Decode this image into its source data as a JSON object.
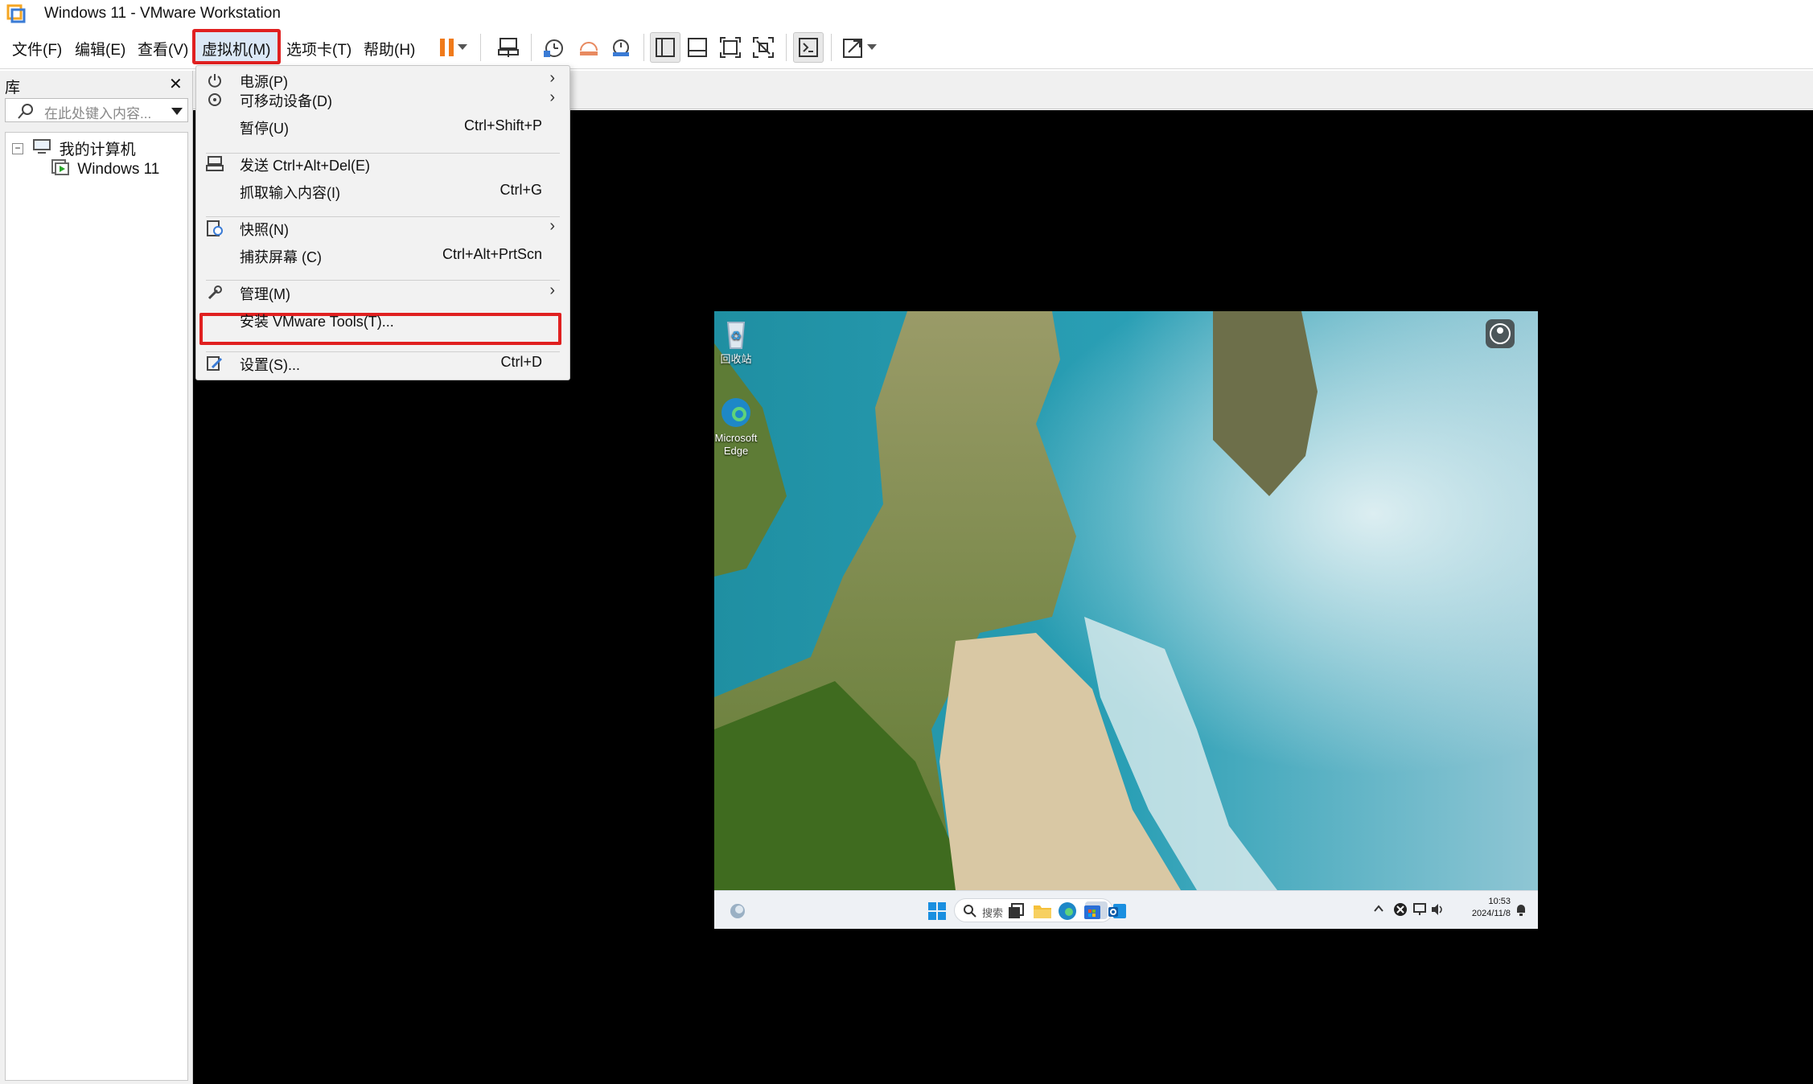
{
  "window": {
    "title": "Windows 11 - VMware Workstation",
    "app_icon": "vmware-workstation-icon"
  },
  "menubar": {
    "items": [
      {
        "label": "文件(F)"
      },
      {
        "label": "编辑(E)"
      },
      {
        "label": "查看(V)"
      },
      {
        "label": "虚拟机(M)",
        "active": true
      },
      {
        "label": "选项卡(T)"
      },
      {
        "label": "帮助(H)"
      }
    ]
  },
  "toolbar": {
    "icons": [
      "pause-icon",
      "dropdown-arrow-icon",
      "send-ctrl-alt-del-icon",
      "snapshot-take-icon",
      "snapshot-revert-icon",
      "snapshot-manager-icon",
      "show-library-icon",
      "show-thumbnail-bar-icon",
      "fullscreen-icon",
      "unity-icon",
      "console-view-icon",
      "stretch-guest-icon",
      "dropdown-arrow-icon"
    ]
  },
  "library": {
    "title": "库",
    "close_icon": "close-icon",
    "search_placeholder": "在此处键入内容...",
    "tree": [
      {
        "label": "我的计算机",
        "icon": "my-computer-icon",
        "expand_icon": "collapse-minus-icon"
      },
      {
        "label": "Windows 11",
        "icon": "vm-running-icon"
      }
    ]
  },
  "vm_menu": {
    "items": [
      {
        "label": "电源(P)",
        "icon": "power-icon",
        "submenu": true
      },
      {
        "label": "可移动设备(D)",
        "icon": "removable-devices-icon",
        "submenu": true
      },
      {
        "label": "暂停(U)",
        "shortcut": "Ctrl+Shift+P"
      },
      {
        "label": "发送 Ctrl+Alt+Del(E)",
        "icon": "send-keys-icon"
      },
      {
        "label": "抓取输入内容(I)",
        "shortcut": "Ctrl+G"
      },
      {
        "label": "快照(N)",
        "icon": "snapshot-icon",
        "submenu": true
      },
      {
        "label": "捕获屏幕 (C)",
        "shortcut": "Ctrl+Alt+PrtScn"
      },
      {
        "label": "管理(M)",
        "icon": "wrench-icon",
        "submenu": true
      },
      {
        "label": "安装 VMware Tools(T)...",
        "highlighted": true
      },
      {
        "label": "设置(S)...",
        "icon": "settings-icon",
        "shortcut": "Ctrl+D"
      }
    ]
  },
  "guest": {
    "desktop_icons": [
      {
        "label": "回收站",
        "icon": "recycle-bin-icon"
      },
      {
        "label": "Microsoft Edge",
        "icon": "edge-icon"
      }
    ],
    "spotlight_icon": "learn-about-picture-icon",
    "taskbar": {
      "search_label": "搜索",
      "time": "10:53",
      "date": "2024/11/8"
    },
    "highlight_color": "#e02020"
  }
}
